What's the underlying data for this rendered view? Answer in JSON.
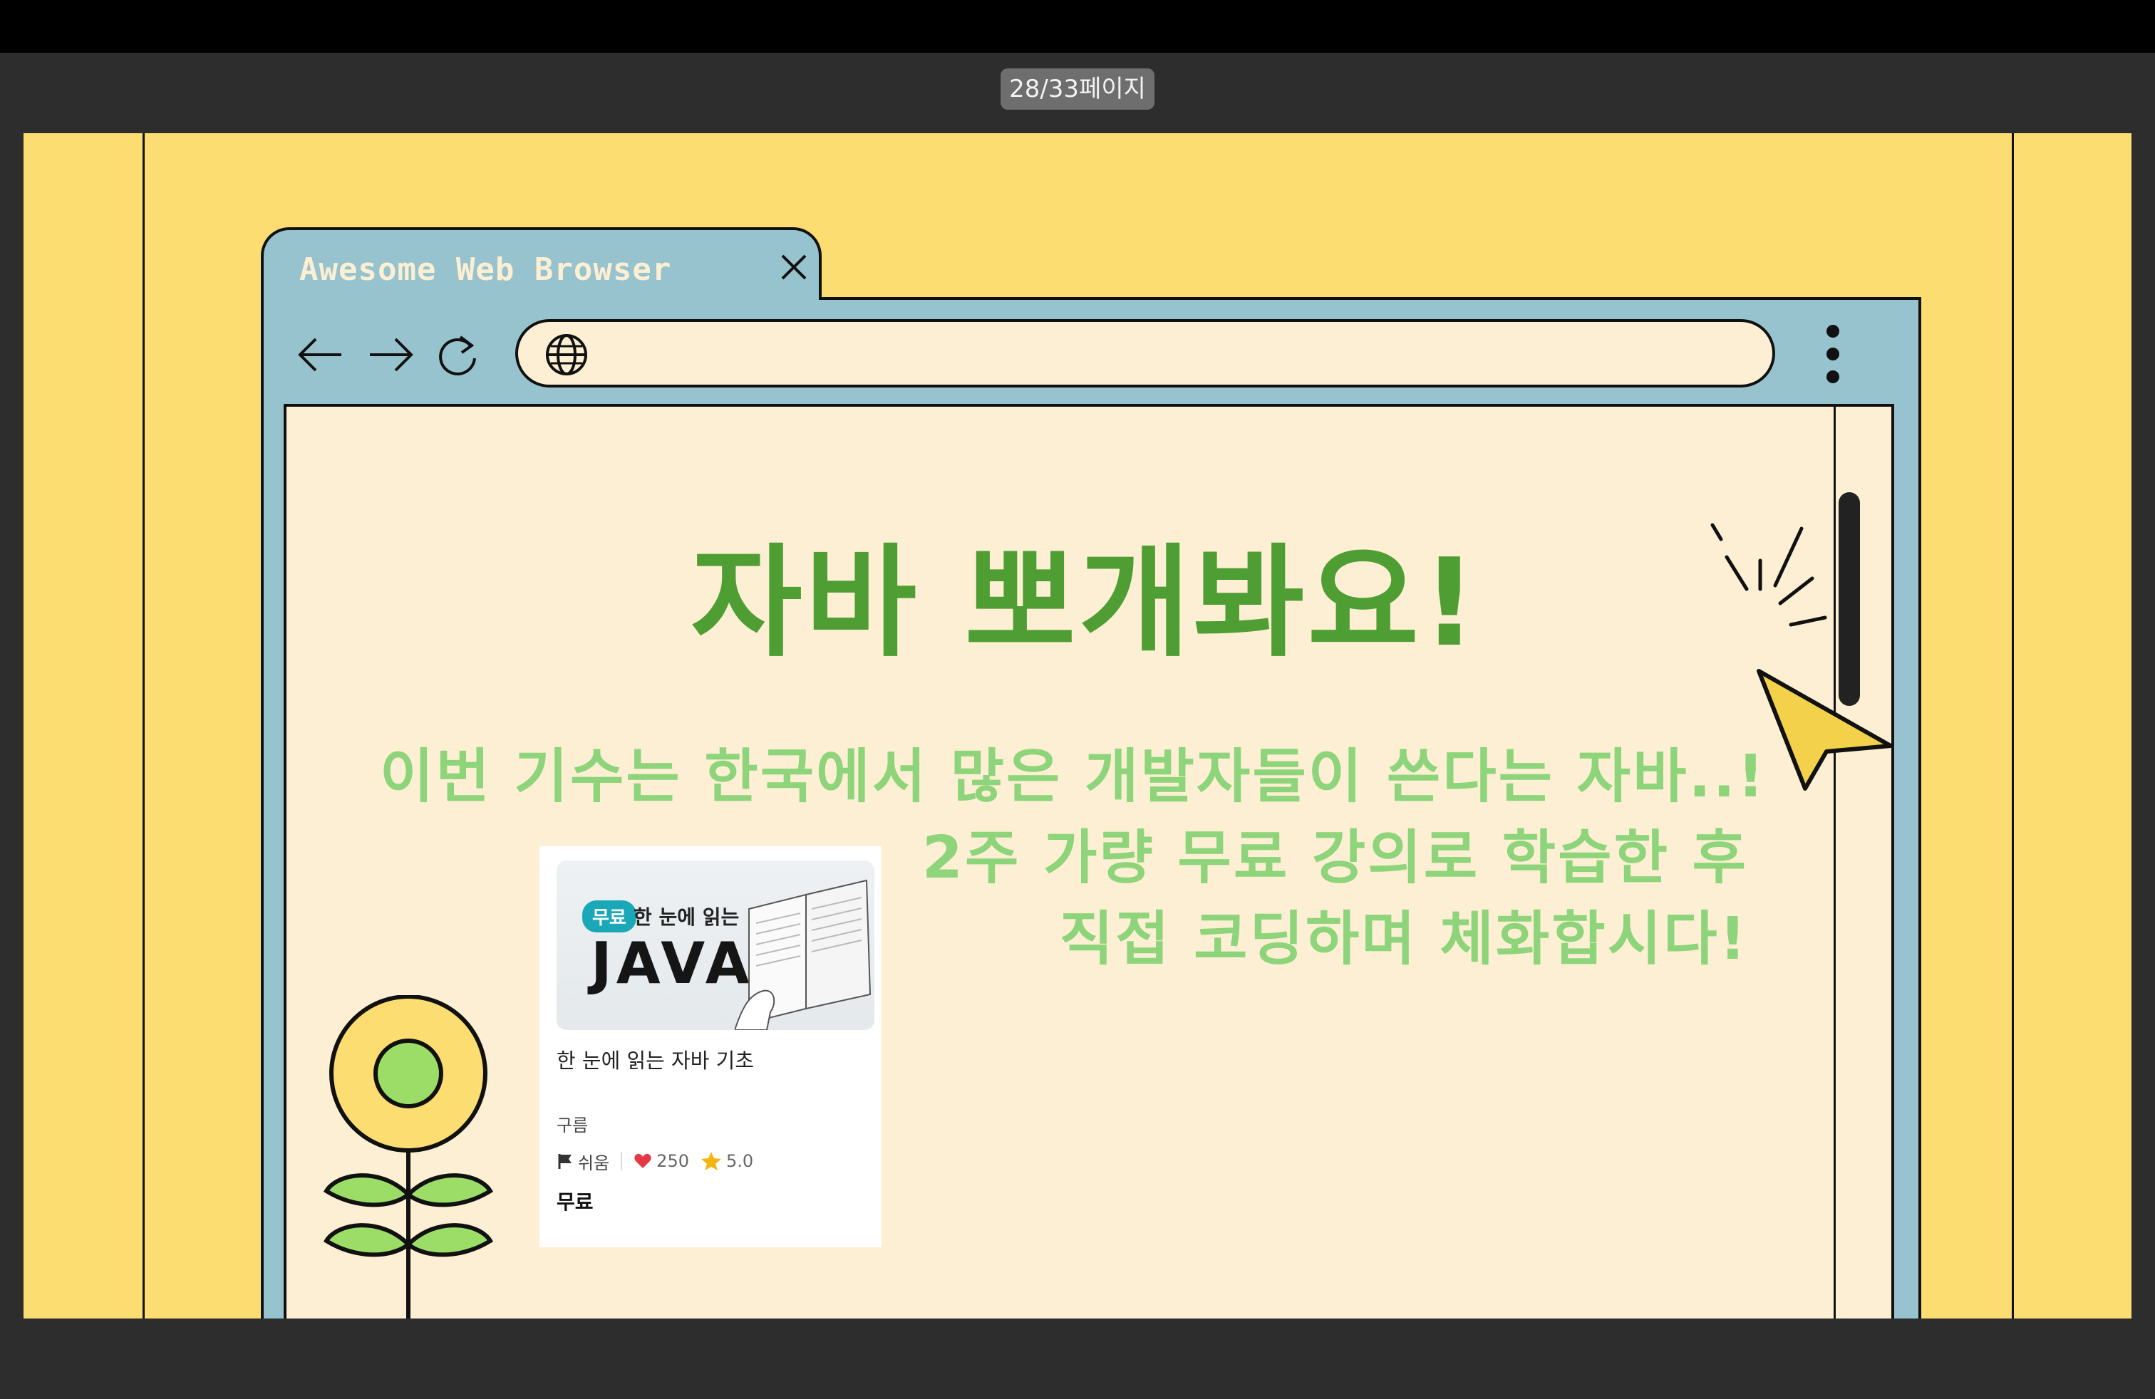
{
  "viewer": {
    "page_indicator": "28/33페이지"
  },
  "colors": {
    "slide_bg": "#fbdd72",
    "browser_frame": "#97c3cf",
    "content_bg": "#fcefd3",
    "headline": "#4f9e33",
    "subtext": "#8dd47a"
  },
  "browser": {
    "tab_title": "Awesome Web Browser",
    "icons": [
      "close-icon",
      "back-arrow-icon",
      "forward-arrow-icon",
      "reload-icon",
      "globe-icon",
      "more-vert-icon"
    ]
  },
  "slide": {
    "headline": "자바 뽀개봐요!",
    "subtext_lines": [
      "이번 기수는 한국에서 많은 개발자들이 쓴다는 자바..!",
      "2주 가량 무료 강의로 학습한 후",
      "직접 코딩하며 체화합시다!"
    ]
  },
  "course_card": {
    "thumbnail": {
      "badge": "무료",
      "subtitle": "한 눈에 읽는",
      "title": "JAVA"
    },
    "title": "한 눈에 읽는 자바 기초",
    "provider": "구름",
    "difficulty": "쉬움",
    "likes": "250",
    "rating": "5.0",
    "price": "무료"
  }
}
